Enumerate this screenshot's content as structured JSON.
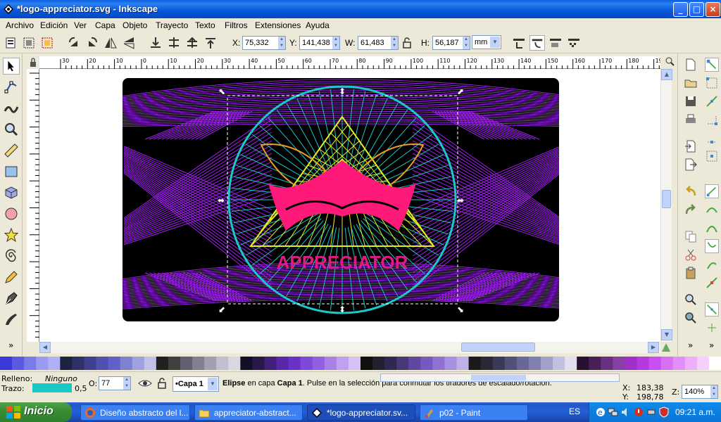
{
  "window": {
    "title": "*logo-appreciator.svg - Inkscape",
    "buttons": {
      "minimize": "_",
      "maximize": "□",
      "close": "×"
    }
  },
  "menu": [
    "Archivo",
    "Edición",
    "Ver",
    "Capa",
    "Objeto",
    "Trayecto",
    "Texto",
    "Filtros",
    "Extensiones",
    "Ayuda"
  ],
  "toolbar": {
    "x_label": "X:",
    "x_value": "75,332",
    "y_label": "Y:",
    "y_value": "141,438",
    "w_label": "W:",
    "w_value": "61,483",
    "h_label": "H:",
    "h_value": "56,187",
    "unit": "mm"
  },
  "ruler": {
    "top_ticks": [
      "30",
      "20",
      "10",
      "0",
      "10",
      "20",
      "30",
      "40",
      "50",
      "60",
      "70",
      "80",
      "90",
      "100",
      "110",
      "120",
      "130",
      "140",
      "150",
      "160",
      "170",
      "180",
      "190"
    ]
  },
  "logo": {
    "text": "APPRECIATOR"
  },
  "colors": {
    "logo_bg": "#000000",
    "purple": "#a020f0",
    "pink": "#ff1a7a",
    "cyan": "#1ac8c8",
    "yellow": "#e6f020",
    "orange": "#f0a020"
  },
  "palette": [
    "#3a3ad8",
    "#5a5ae0",
    "#7a7ae8",
    "#9a9af0",
    "#b0b0f4",
    "#202040",
    "#303068",
    "#404090",
    "#5050b0",
    "#6060c8",
    "#8080d0",
    "#a0a0e0",
    "#c0c0e8",
    "#202020",
    "#404040",
    "#606070",
    "#808090",
    "#a0a0b0",
    "#c0c0d0",
    "#d8d8e0",
    "#101028",
    "#281848",
    "#402078",
    "#5828a8",
    "#6a30c8",
    "#7e48d8",
    "#9060e0",
    "#a880e8",
    "#c0a0f0",
    "#d8c0f4",
    "#101010",
    "#202030",
    "#302850",
    "#483878",
    "#6048a0",
    "#7858c0",
    "#9070d0",
    "#a890e0",
    "#c0b0e8",
    "#1a1a1a",
    "#282838",
    "#3a3a58",
    "#505078",
    "#686898",
    "#8080b0",
    "#a0a0c8",
    "#c0c0e0",
    "#e0e0f0",
    "#2a1030",
    "#482058",
    "#683080",
    "#8840a8",
    "#a030c8",
    "#b838e0",
    "#c850f0",
    "#d870f4",
    "#e090f8",
    "#ecb0fa",
    "#f4d0fc",
    "#ffffff"
  ],
  "status": {
    "fill_label": "Relleno:",
    "fill_value": "Ninguno",
    "stroke_label": "Trazo:",
    "stroke_width": "0,5",
    "opacity_label": "O:",
    "opacity_value": "77",
    "layer": "•Capa 1",
    "message_obj": "Elipse",
    "message_mid": " en capa ",
    "message_layer": "Capa 1",
    "message_rest": ". Pulse en la selección para conmutar los tiradores de escalado/rotación.",
    "cursor_x_label": "X:",
    "cursor_x": "183,38",
    "cursor_y_label": "Y:",
    "cursor_y": "198,78",
    "zoom_label": "Z:",
    "zoom": "140%"
  },
  "taskbar": {
    "start": "Inicio",
    "tasks": [
      "Diseño abstracto del l...",
      "appreciator-abstract...",
      "*logo-appreciator.sv...",
      "p02 - Paint"
    ],
    "lang": "ES",
    "clock": "09:21 a.m."
  }
}
